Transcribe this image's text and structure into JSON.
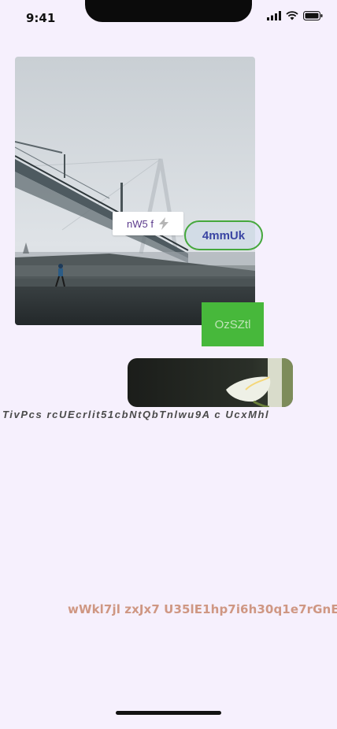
{
  "status_bar": {
    "time": "9:41",
    "icons": [
      "signal-icon",
      "wifi-icon",
      "battery-icon"
    ]
  },
  "hero": {
    "image": "foggy-bridge-photo"
  },
  "chip": {
    "label": "nW5 f",
    "icon": "bolt-icon"
  },
  "outline_button": {
    "label": "4mmUk"
  },
  "green_button": {
    "label": "OzSZtl"
  },
  "thumbnail": {
    "image": "calla-lily-photo"
  },
  "caption": {
    "text": "TivPcs rcUEcrlit51cbNtQbTnlwu9A c UcxMhl"
  },
  "footer": {
    "text": "wWkl7jl zxJx7 U35lE1hp7i6h30q1e7rGnE"
  },
  "colors": {
    "background": "#f6f0fd",
    "accent_green": "#47b83b",
    "outline_text": "#3a45a3",
    "footer_text": "#cf9783"
  }
}
